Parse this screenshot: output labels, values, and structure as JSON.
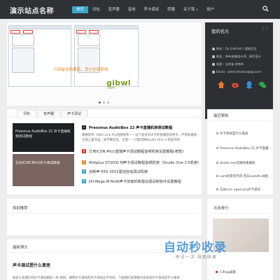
{
  "header": {
    "logo": "演示站点名称",
    "nav": [
      "首页",
      "词包",
      "变声器",
      "音效",
      "声卡调试",
      "转播",
      "关于我 »",
      "用户"
    ]
  },
  "banner": {
    "caption": "只保留这两通道，其它全部禁用",
    "watermark": "gibwl",
    "watermark_sub": ".com"
  },
  "profile": {
    "title": "我的名片",
    "lines": [
      {
        "icon": "user-icon",
        "text": "网名：Fly LinkFish丨德耐比比"
      },
      {
        "icon": "briefcase-icon",
        "text": "职业：Web前端设计师、网页设计"
      },
      {
        "icon": "home-icon",
        "text": "现居：山东省-济南市"
      },
      {
        "icon": "mail-icon",
        "text": "Email：administrator@qq.com"
      }
    ],
    "social": [
      "home-icon",
      "weibo-icon",
      "qq-icon",
      "wechat-icon"
    ],
    "colors": {
      "home": "#e8792b",
      "weibo": "#d84a3a",
      "qq": "#2f8fd6",
      "wechat": "#2aa84a"
    }
  },
  "tabs": [
    "词包",
    "变声器",
    "声卡调试"
  ],
  "featured": [
    {
      "thumb": "Presonus AudioBox 22 声卡直播机架测试教程",
      "title": "Presonus AudioBox 22 声卡直播机架测试教程",
      "summary": "需要软件: ASIO Link Pro直接软件——这个是没有声卡的直播音效用于，不用的通道全部上面点击，请不要连连，全部——只能切换Studio One 3 机架为例"
    },
    {
      "thumb": "艾肯ICON MicU声卡调试教程",
      "title": "艾肯ICON MicU直播声卡调试教程音频机架设置教程(老款)"
    }
  ],
  "list": [
    "艾肯ICON MicU直播声卡调试教程音频机架设置教程(老款)",
    "Midiplus STUDIO M声卡调试教程音频机架（Studio One 3.5机架）",
    "创新声卡KX 3552驱动自动调试机架",
    "DII Mega M-NUAI声卡安装机架驱动调试和软件设置教程"
  ],
  "recent": {
    "title": "最近更新",
    "items": [
      "声卡调试是什么意思",
      "Presonus AudioBox 22 声卡直播...",
      "studio one交换效果器机",
      "sam机架的不开-音乐samdll.dll配...",
      "艾肯icon upod pro声卡调试"
    ]
  },
  "special": {
    "title": "特别推荐"
  },
  "rank": {
    "title": "点击排行",
    "items": [
      "人声qq录歌"
    ]
  },
  "latest": {
    "title": "最新博文",
    "post_title": "声卡调试是什么意思",
    "post_text": "很多人说我们的声卡调试都是一样-提样，要把声卡调试的声卡调试这不同的。下面我们就来跟大家说说声卡调试是什么意思"
  },
  "bottom_watermark": {
    "main": "自动秒收录",
    "sub": "·来访一次·自动收录"
  }
}
